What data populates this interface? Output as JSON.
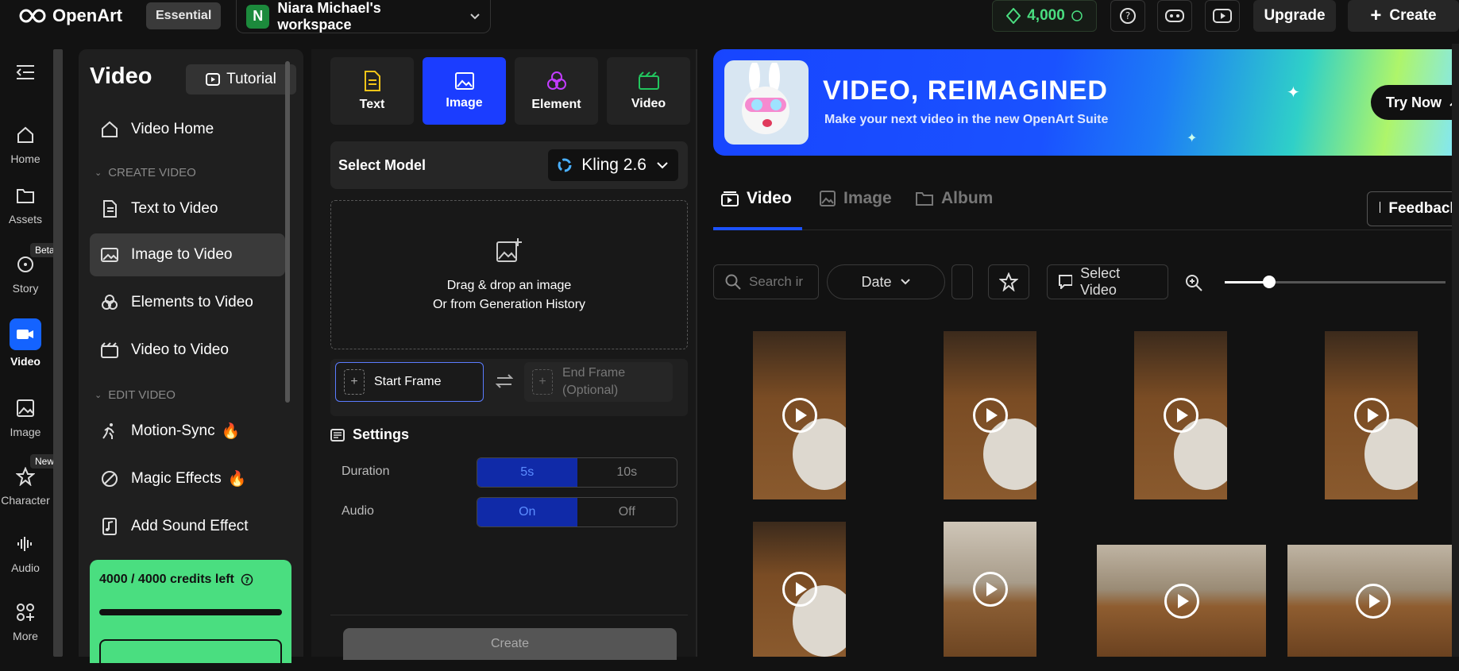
{
  "topbar": {
    "brand": "OpenArt",
    "plan": "Essential",
    "workspace_initial": "N",
    "workspace": "Niara Michael's workspace",
    "credits": "4,000",
    "upgrade": "Upgrade",
    "create": "Create"
  },
  "leftnav": {
    "items": [
      {
        "label": "Home"
      },
      {
        "label": "Assets"
      },
      {
        "label": "Story",
        "tag": "Beta"
      },
      {
        "label": "Video"
      },
      {
        "label": "Image"
      },
      {
        "label": "Character",
        "tag": "New"
      },
      {
        "label": "Audio"
      },
      {
        "label": "More"
      }
    ]
  },
  "sidepanel": {
    "title": "Video",
    "tutorial": "Tutorial",
    "home": "Video Home",
    "section_create": "CREATE VIDEO",
    "text_to_video": "Text to Video",
    "image_to_video": "Image to Video",
    "elements_to_video": "Elements to Video",
    "video_to_video": "Video to Video",
    "section_edit": "EDIT VIDEO",
    "motion_sync": "Motion-Sync",
    "magic_effects": "Magic Effects",
    "add_sound": "Add Sound Effect",
    "credits_left": "4000 / 4000 credits left"
  },
  "config": {
    "modes": [
      "Text",
      "Image",
      "Element",
      "Video"
    ],
    "select_model": "Select Model",
    "model": "Kling 2.6",
    "drop_line1": "Drag & drop an image",
    "drop_line2": "Or from Generation History",
    "start_frame": "Start Frame",
    "end_frame_1": "End Frame",
    "end_frame_2": "(Optional)",
    "settings": "Settings",
    "duration": "Duration",
    "dur_a": "5s",
    "dur_b": "10s",
    "audio": "Audio",
    "aud_a": "On",
    "aud_b": "Off",
    "create": "Create"
  },
  "right": {
    "banner_title": "VIDEO, REIMAGINED",
    "banner_sub": "Make your next video in the new OpenArt Suite",
    "try_now": "Try Now",
    "tab_video": "Video",
    "tab_image": "Image",
    "tab_album": "Album",
    "feedback": "Feedback",
    "search_placeholder": "Search ir",
    "date": "Date",
    "select_video": "Select Video",
    "zoom": 0.2
  },
  "colors": {
    "accent": "#1c52ff",
    "credit_green": "#4ade80",
    "mode_selected": "#1b3dff"
  }
}
